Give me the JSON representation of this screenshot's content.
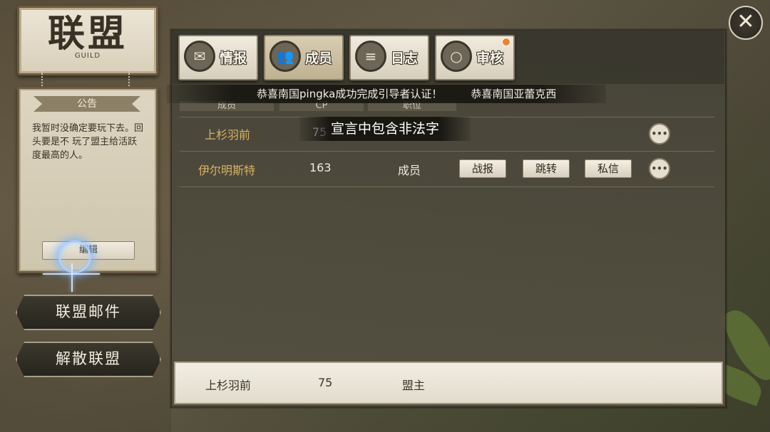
{
  "header": {
    "title": "联盟",
    "subtitle": "GUILD"
  },
  "notice": {
    "heading": "公告",
    "text": "我暂时没确定要玩下去。回头要是不 玩了盟主给活跃度最高的人。",
    "edit_label": "编辑"
  },
  "side_buttons": {
    "mail": "联盟邮件",
    "disband": "解散联盟"
  },
  "tabs": [
    {
      "label": "情报",
      "icon": "envelope-icon"
    },
    {
      "label": "成员",
      "icon": "members-icon",
      "active": true
    },
    {
      "label": "日志",
      "icon": "logbook-icon"
    },
    {
      "label": "审核",
      "icon": "magnifier-icon",
      "badge": true
    }
  ],
  "ticker": {
    "msg1": "恭喜南国pingka成功完成引导者认证！",
    "msg2": "恭喜南国亚蕾克西"
  },
  "columns": {
    "c1": "成员",
    "c2": "CP",
    "c3": "职位"
  },
  "members": [
    {
      "name": "上杉羽前",
      "cp": "75",
      "role": ""
    },
    {
      "name": "伊尔明斯特",
      "cp": "163",
      "role": "成员"
    }
  ],
  "row_actions": {
    "report": "战报",
    "jump": "跳转",
    "message": "私信",
    "more": "•••"
  },
  "toast": "宣言中包含非法字",
  "self_row": {
    "name": "上杉羽前",
    "cp": "75",
    "role": "盟主"
  },
  "close_label": "✕",
  "colors": {
    "accent_name": "#d9b263",
    "panel": "#4f4c3f",
    "badge": "#e8843a"
  }
}
